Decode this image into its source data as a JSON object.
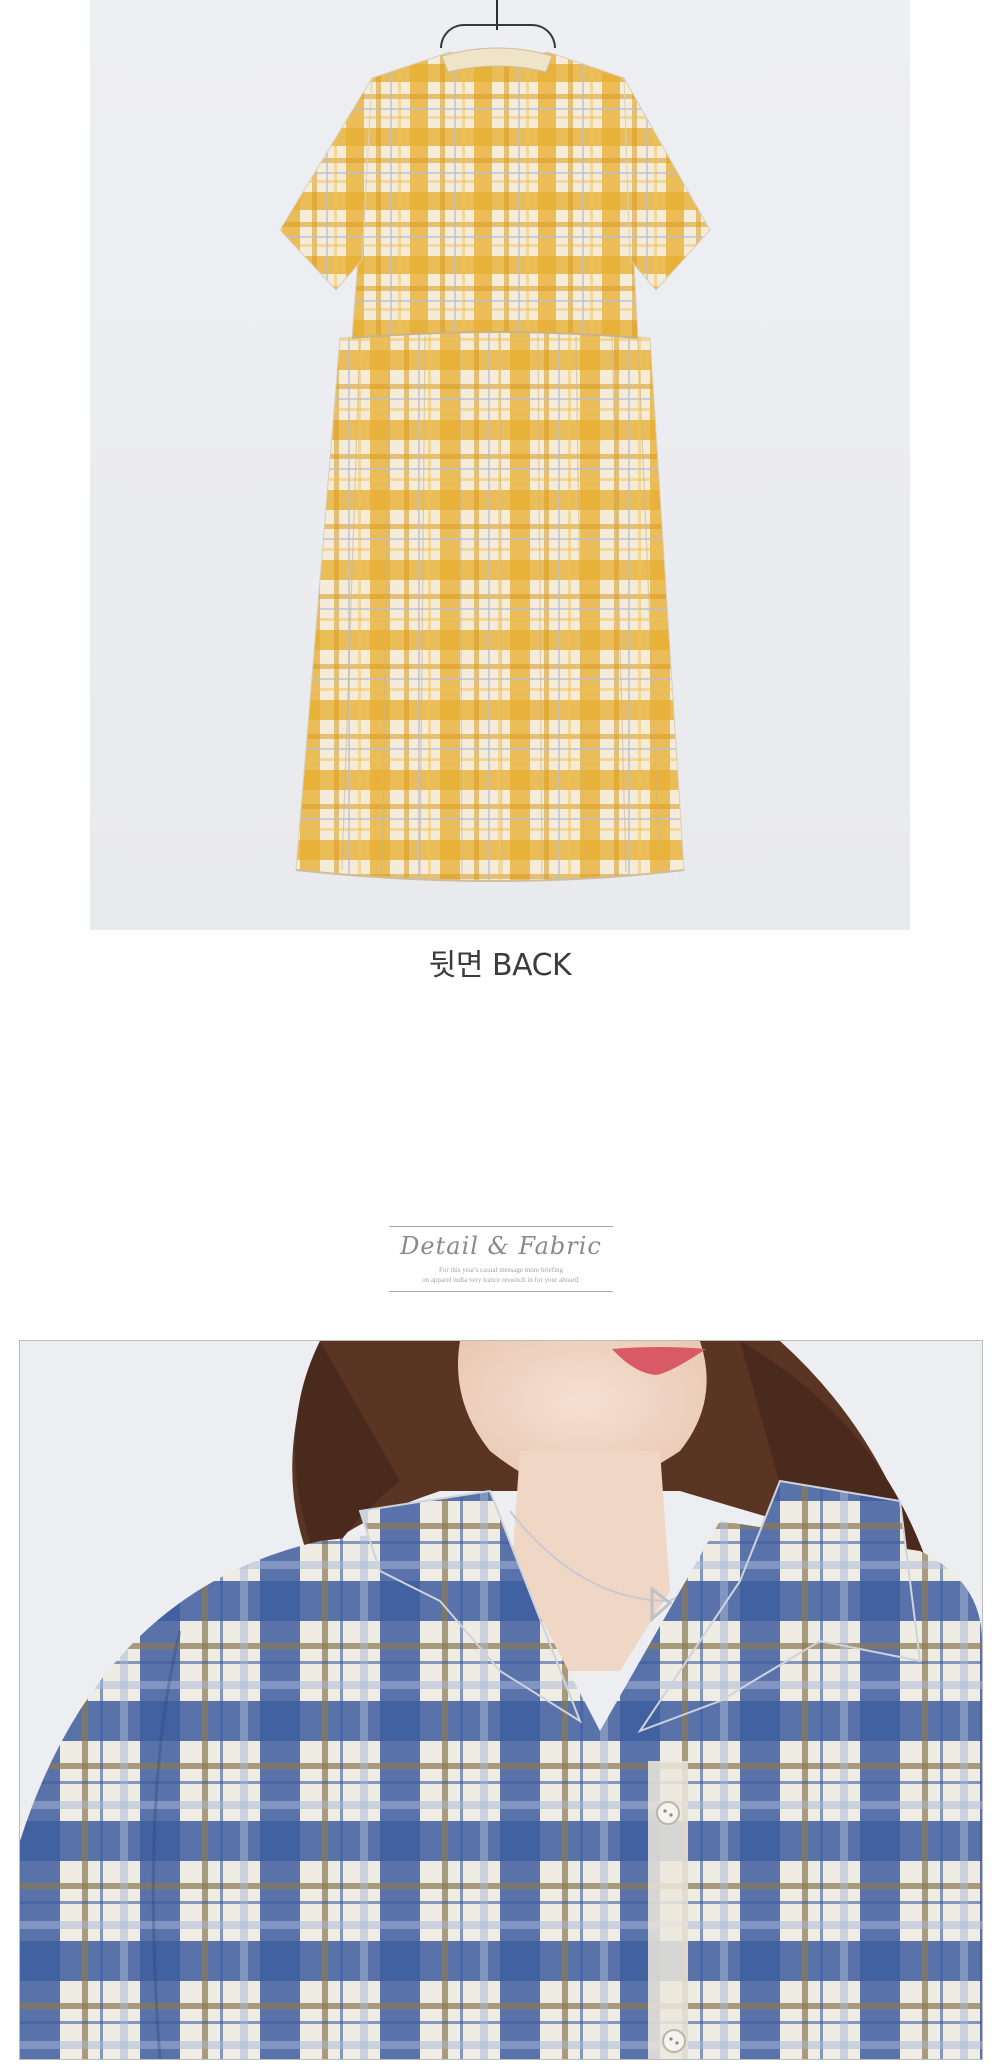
{
  "product_photos": {
    "back_view": {
      "caption": "뒷면 BACK"
    },
    "detail_view": {}
  },
  "detail_header": {
    "title": "Detail & Fabric",
    "subtitle_line1": "For this year's casual message more briefing",
    "subtitle_line2": "on apparel india very trance reswitch in for your aboard."
  },
  "colors": {
    "yellow_plaid": "#e3a82a",
    "cream": "#f3ebd8",
    "blue_plaid": "#3e5ea0",
    "backdrop": "#ecedf0",
    "caption_text": "#3c3c3c"
  }
}
